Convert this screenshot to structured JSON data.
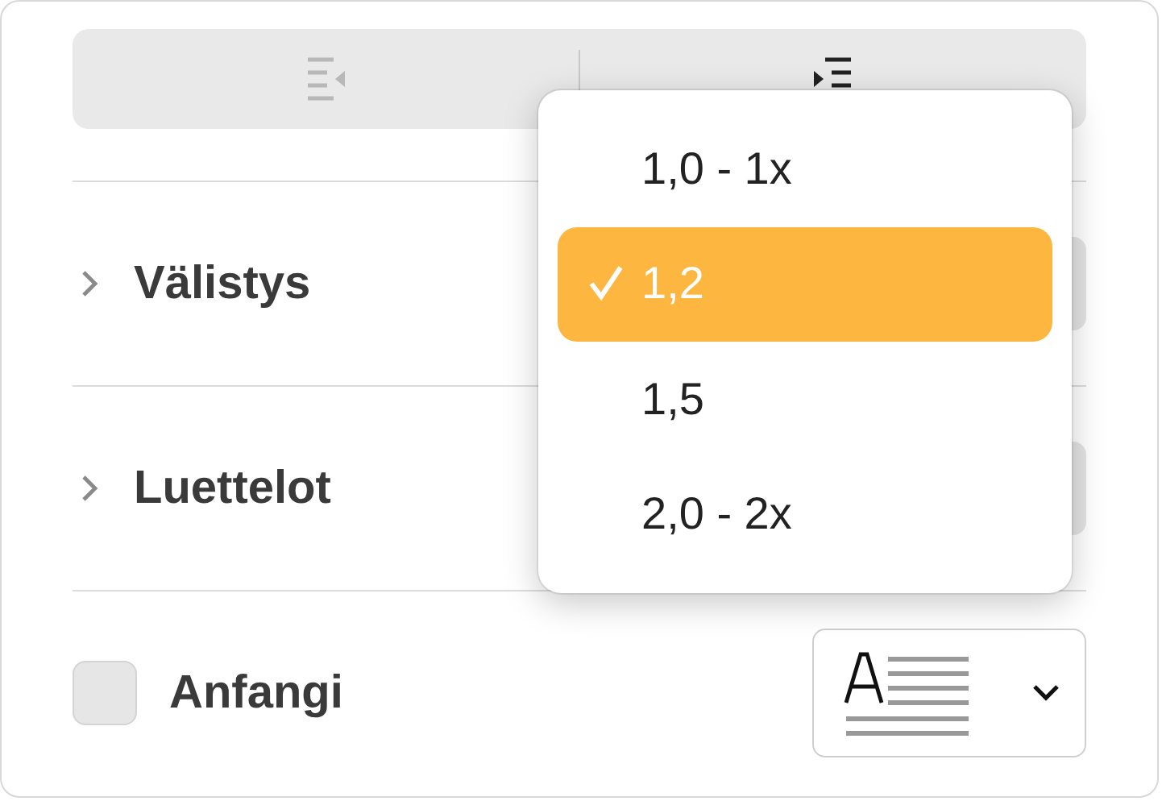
{
  "sections": [
    {
      "label": "Välistys",
      "expanded": false
    },
    {
      "label": "Luettelot",
      "expanded": false
    }
  ],
  "drop_cap": {
    "label": "Anfangi",
    "checked": false
  },
  "menu": {
    "items": [
      {
        "label": "1,0 - 1x",
        "selected": false
      },
      {
        "label": "1,2",
        "selected": true
      },
      {
        "label": "1,5",
        "selected": false
      },
      {
        "label": "2,0 - 2x",
        "selected": false
      }
    ]
  }
}
